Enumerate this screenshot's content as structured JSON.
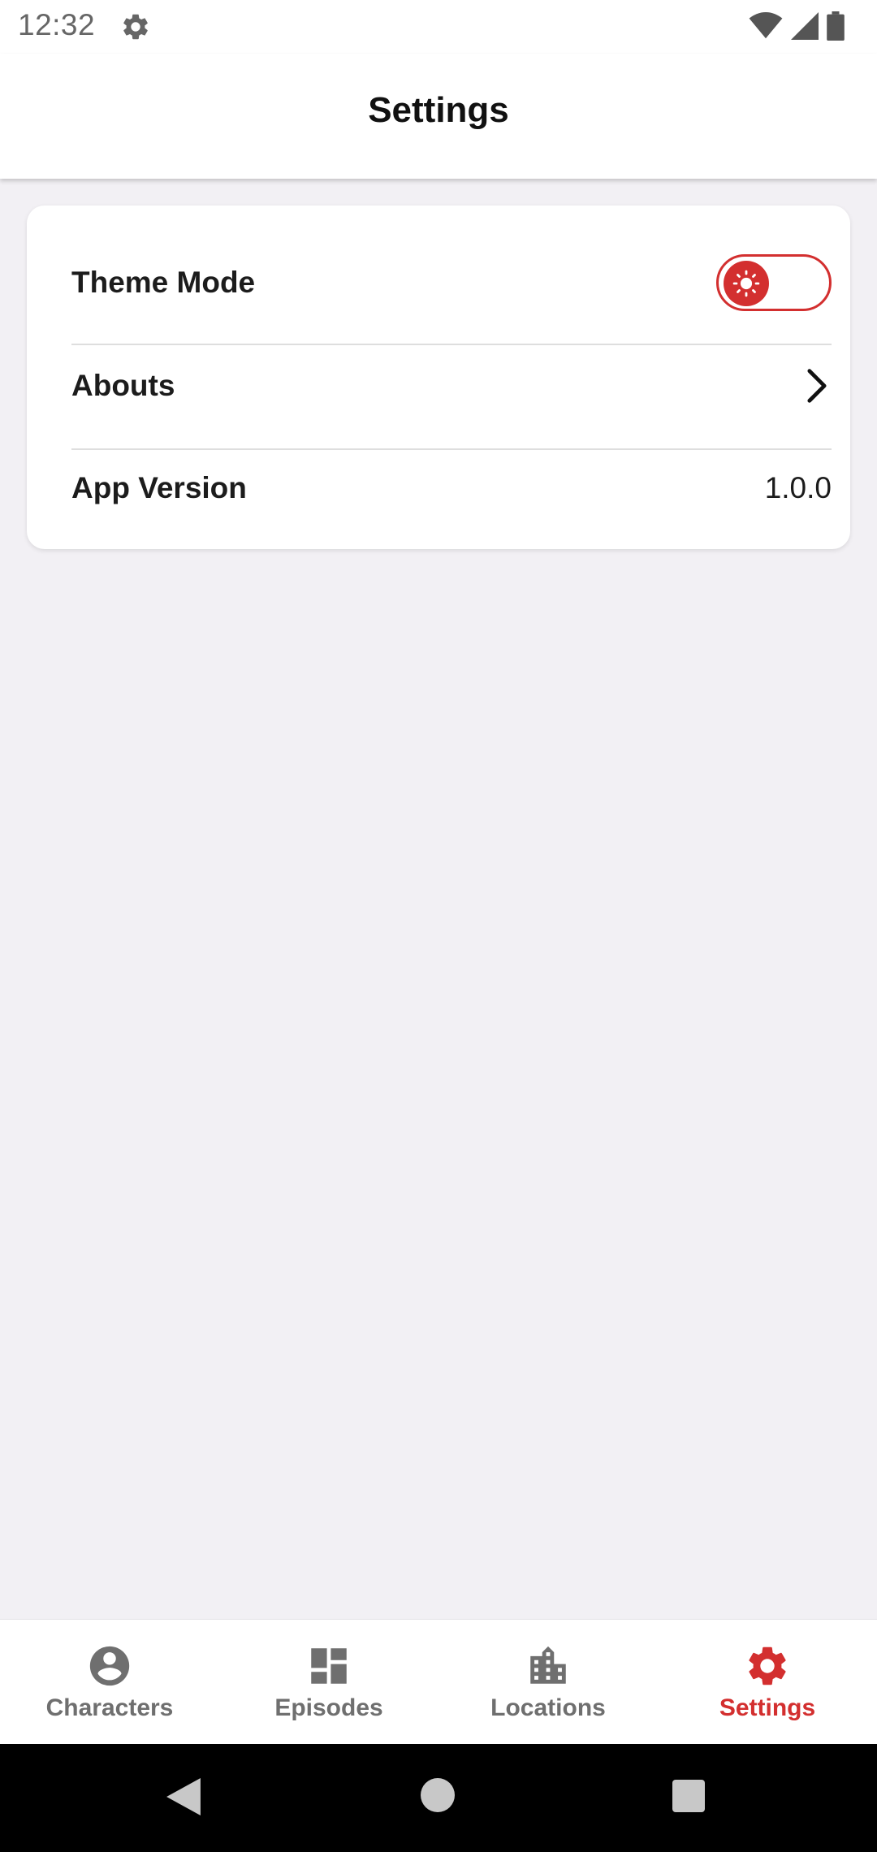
{
  "status_bar": {
    "time": "12:32",
    "icons": [
      "settings-icon",
      "wifi-icon",
      "signal-icon",
      "battery-icon"
    ]
  },
  "app_bar": {
    "title": "Settings"
  },
  "settings": {
    "theme_mode_label": "Theme Mode",
    "theme_toggle_state": "light",
    "abouts_label": "Abouts",
    "app_version_label": "App Version",
    "app_version_value": "1.0.0"
  },
  "bottom_nav": {
    "items": [
      {
        "label": "Characters",
        "icon": "person-icon",
        "active": false
      },
      {
        "label": "Episodes",
        "icon": "dashboard-icon",
        "active": false
      },
      {
        "label": "Locations",
        "icon": "building-icon",
        "active": false
      },
      {
        "label": "Settings",
        "icon": "gear-icon",
        "active": true
      }
    ]
  },
  "colors": {
    "accent": "#d32f2f",
    "background": "#f2f0f4",
    "inactive": "#6f6f6f"
  }
}
